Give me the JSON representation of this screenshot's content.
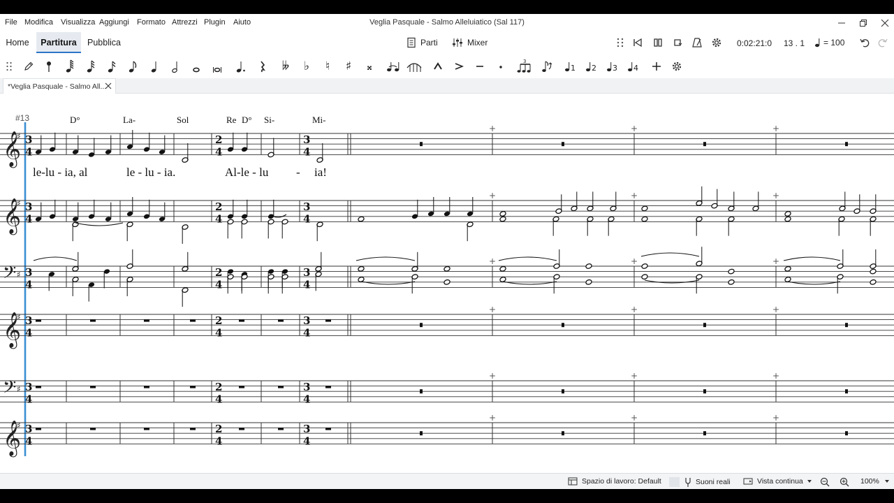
{
  "menu": [
    "File",
    "Modifica",
    "Visualizza",
    "Aggiungi",
    "Formato",
    "Attrezzi",
    "Plugin",
    "Aiuto"
  ],
  "window_title": "Veglia Pasquale - Salmo Alleluiatico (Sal 117)",
  "tabs": {
    "home": "Home",
    "score": "Partitura",
    "publish": "Pubblica"
  },
  "toolbar": {
    "parts": "Parti",
    "mixer": "Mixer",
    "time": "0:02:21:0",
    "position": "13 . 1",
    "tempo": "= 100"
  },
  "note_input": {
    "accidentals": [
      "𝄫",
      "♭",
      "♮",
      "♯",
      "𝄪"
    ],
    "voices": [
      "1",
      "2",
      "3",
      "4"
    ]
  },
  "document_tab": "*Veglia Pasquale - Salmo All...",
  "score": {
    "measure_number": "#13",
    "chords": [
      "D°",
      "La-",
      "Sol",
      "Re",
      "D°",
      "Si-",
      "Mi-"
    ],
    "lyrics": [
      "le-lu - ia, al",
      "le - lu - ia.",
      "Al-le - lu",
      "-",
      "ia!"
    ]
  },
  "status": {
    "workspace": "Spazio di lavoro: Default",
    "real_pitch": "Suoni reali",
    "view_mode": "Vista continua",
    "zoom": "100%"
  }
}
